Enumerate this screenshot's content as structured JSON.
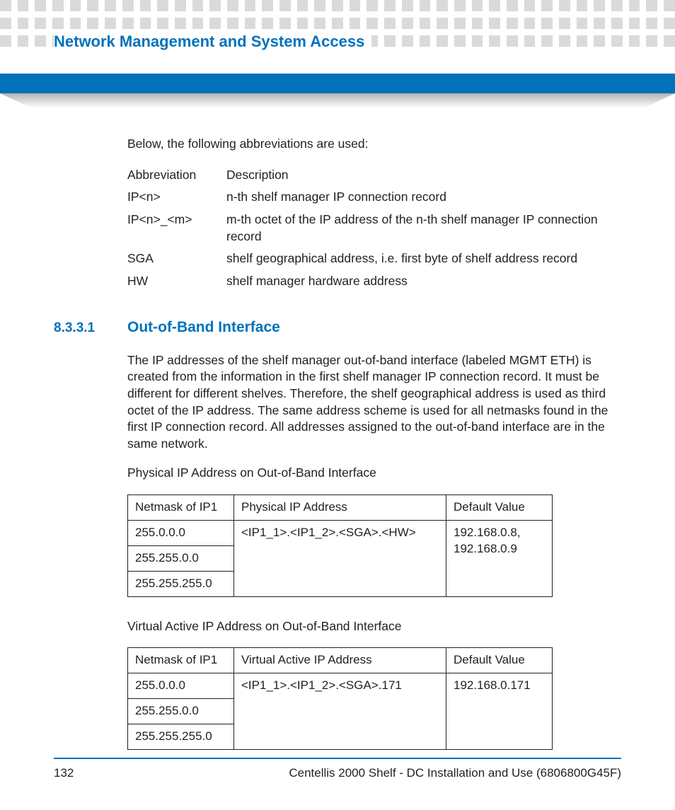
{
  "header": {
    "title": "Network Management and System Access"
  },
  "intro": "Below, the following abbreviations are used:",
  "abbr": {
    "head": {
      "c1": "Abbreviation",
      "c2": "Description"
    },
    "rows": [
      {
        "c1": "IP<n>",
        "c2": "n-th shelf manager IP connection record"
      },
      {
        "c1": "IP<n>_<m>",
        "c2": "m-th octet of the IP address of the n-th shelf manager IP connection record"
      },
      {
        "c1": "SGA",
        "c2": "shelf geographical address, i.e. first byte of shelf address record"
      },
      {
        "c1": "HW",
        "c2": "shelf manager hardware address"
      }
    ]
  },
  "section": {
    "num": "8.3.3.1",
    "title": "Out-of-Band Interface",
    "para": "The IP addresses of the shelf manager out-of-band interface (labeled MGMT ETH) is created from the information in the first shelf manager IP connection record. It must be different for different shelves. Therefore, the shelf geographical address is used as third octet of the IP address. The same address scheme is used for all netmasks found in the first IP connection record. All addresses assigned to the out-of-band interface are in the same network."
  },
  "table1": {
    "caption": "Physical IP Address on Out-of-Band Interface",
    "head": {
      "c1": "Netmask of IP1",
      "c2": "Physical IP Address",
      "c3": "Default Value"
    },
    "r1c1": "255.0.0.0",
    "r2c1": "255.255.0.0",
    "r3c1": "255.255.255.0",
    "addr": "<IP1_1>.<IP1_2>.<SGA>.<HW>",
    "def": "192.168.0.8, 192.168.0.9"
  },
  "table2": {
    "caption": "Virtual Active IP Address on Out-of-Band Interface",
    "head": {
      "c1": "Netmask of IP1",
      "c2": "Virtual Active IP Address",
      "c3": "Default Value"
    },
    "r1c1": "255.0.0.0",
    "r2c1": "255.255.0.0",
    "r3c1": "255.255.255.0",
    "addr": "<IP1_1>.<IP1_2>.<SGA>.171",
    "def": "192.168.0.171"
  },
  "footer": {
    "page": "132",
    "doc": "Centellis 2000 Shelf - DC Installation and Use (6806800G45F)"
  }
}
